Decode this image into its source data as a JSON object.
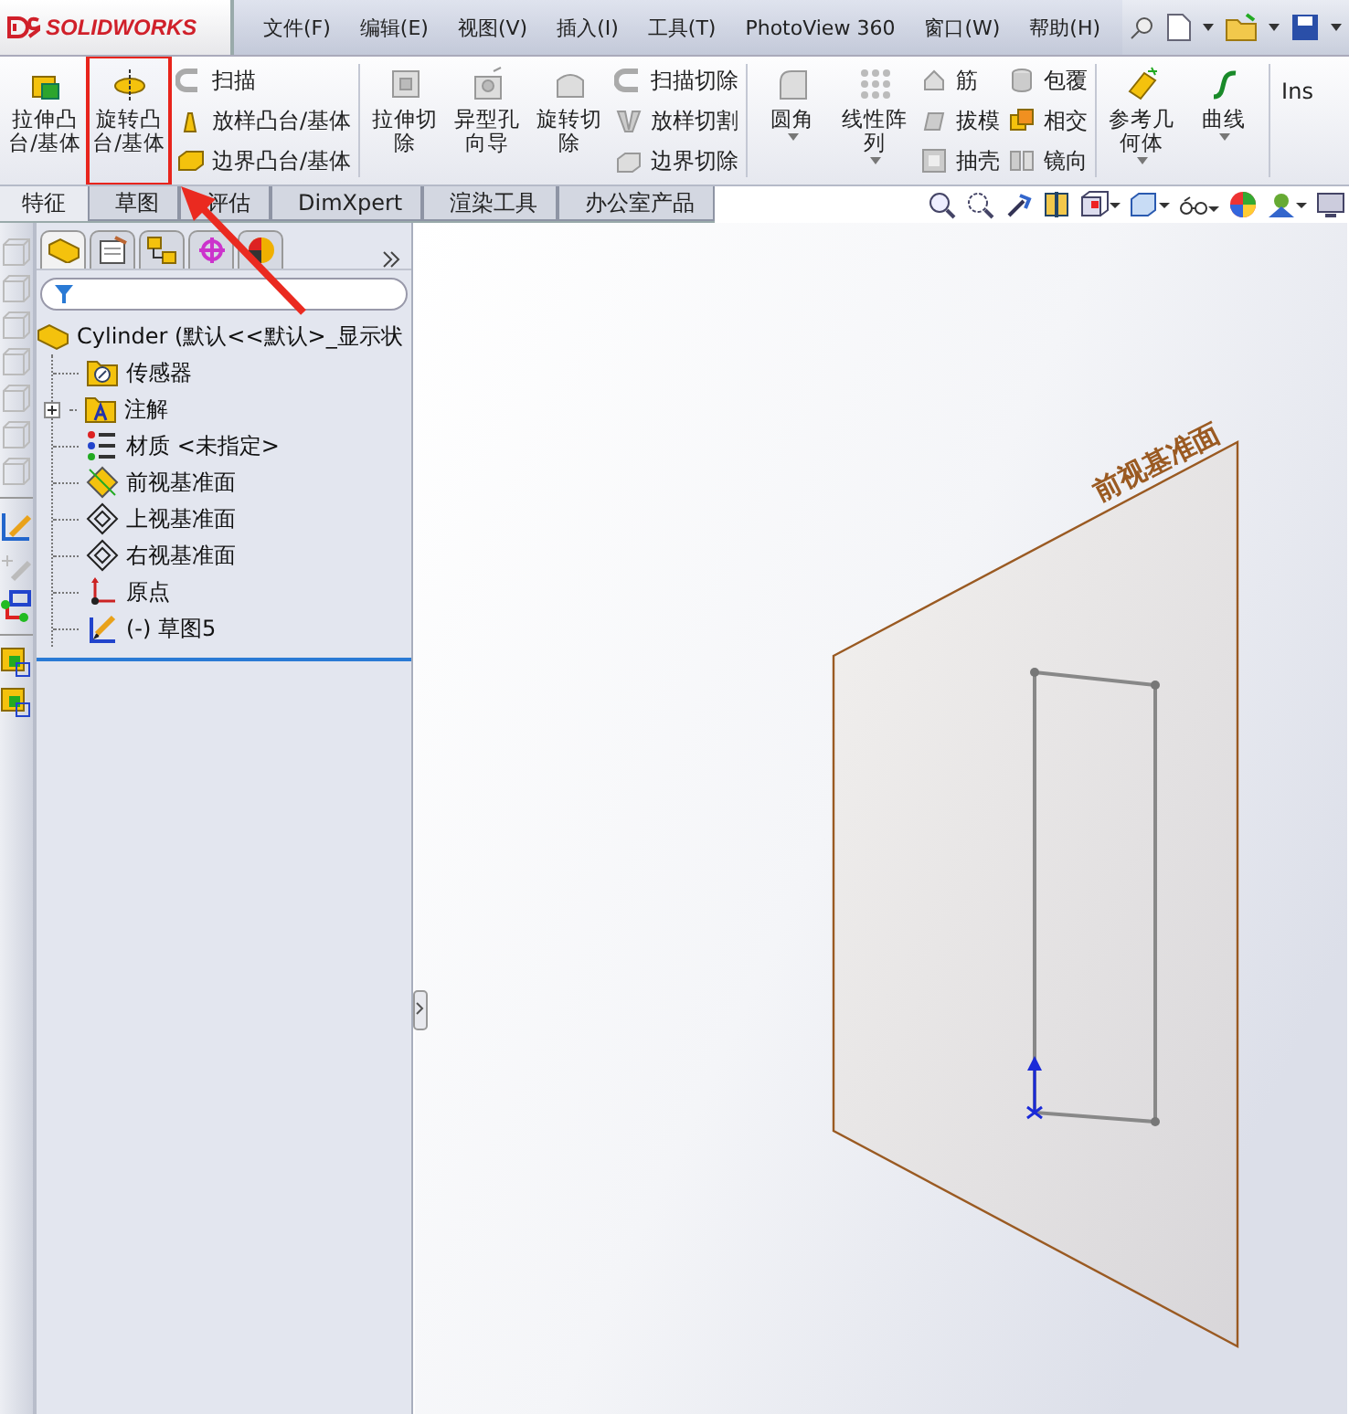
{
  "logo": "SOLIDWORKS",
  "menus": [
    {
      "label": "文件(F)"
    },
    {
      "label": "编辑(E)"
    },
    {
      "label": "视图(V)"
    },
    {
      "label": "插入(I)"
    },
    {
      "label": "工具(T)"
    },
    {
      "label": "PhotoView 360"
    },
    {
      "label": "窗口(W)"
    },
    {
      "label": "帮助(H)"
    }
  ],
  "ribbon": {
    "groups": [
      {
        "kind": "large",
        "items": [
          {
            "label": "拉伸凸台/基体",
            "highlighted": false,
            "has_menu": false
          },
          {
            "label": "旋转凸台/基体",
            "highlighted": true,
            "has_menu": false
          }
        ]
      },
      {
        "kind": "small",
        "items": [
          {
            "label": "扫描"
          },
          {
            "label": "放样凸台/基体"
          },
          {
            "label": "边界凸台/基体"
          }
        ]
      },
      {
        "kind": "separator"
      },
      {
        "kind": "large",
        "items": [
          {
            "label": "拉伸切除",
            "highlighted": false,
            "has_menu": false
          },
          {
            "label": "异型孔向导",
            "highlighted": false,
            "has_menu": false
          },
          {
            "label": "旋转切除",
            "highlighted": false,
            "has_menu": false
          }
        ]
      },
      {
        "kind": "small",
        "items": [
          {
            "label": "扫描切除"
          },
          {
            "label": "放样切割"
          },
          {
            "label": "边界切除"
          }
        ]
      },
      {
        "kind": "separator"
      },
      {
        "kind": "large",
        "items": [
          {
            "label": "圆角",
            "highlighted": false,
            "has_menu": true
          },
          {
            "label": "线性阵列",
            "highlighted": false,
            "has_menu": true
          }
        ]
      },
      {
        "kind": "small",
        "items": [
          {
            "label": "筋"
          },
          {
            "label": "拔模"
          },
          {
            "label": "抽壳"
          }
        ]
      },
      {
        "kind": "small",
        "items": [
          {
            "label": "包覆"
          },
          {
            "label": "相交"
          },
          {
            "label": "镜向"
          }
        ]
      },
      {
        "kind": "separator"
      },
      {
        "kind": "large",
        "items": [
          {
            "label": "参考几何体",
            "highlighted": false,
            "has_menu": true
          },
          {
            "label": "曲线",
            "highlighted": false,
            "has_menu": true
          }
        ]
      },
      {
        "kind": "separator"
      }
    ],
    "overflow": "Ins"
  },
  "command_tabs": [
    {
      "label": "特征",
      "selected": true
    },
    {
      "label": "草图",
      "selected": false
    },
    {
      "label": "评估",
      "selected": false
    },
    {
      "label": "DimXpert",
      "selected": false
    },
    {
      "label": "渲染工具",
      "selected": false
    },
    {
      "label": "办公室产品",
      "selected": false
    }
  ],
  "feature_tree": {
    "root": "Cylinder  (默认<<默认>_显示状",
    "items": [
      {
        "label": "传感器"
      },
      {
        "label": "注解",
        "expanded": false
      },
      {
        "label": "材质 <未指定>"
      },
      {
        "label": "前视基准面"
      },
      {
        "label": "上视基准面"
      },
      {
        "label": "右视基准面"
      },
      {
        "label": "原点"
      },
      {
        "label": "(-) 草图5"
      }
    ]
  },
  "viewport": {
    "plane_label": "前视基准面"
  }
}
